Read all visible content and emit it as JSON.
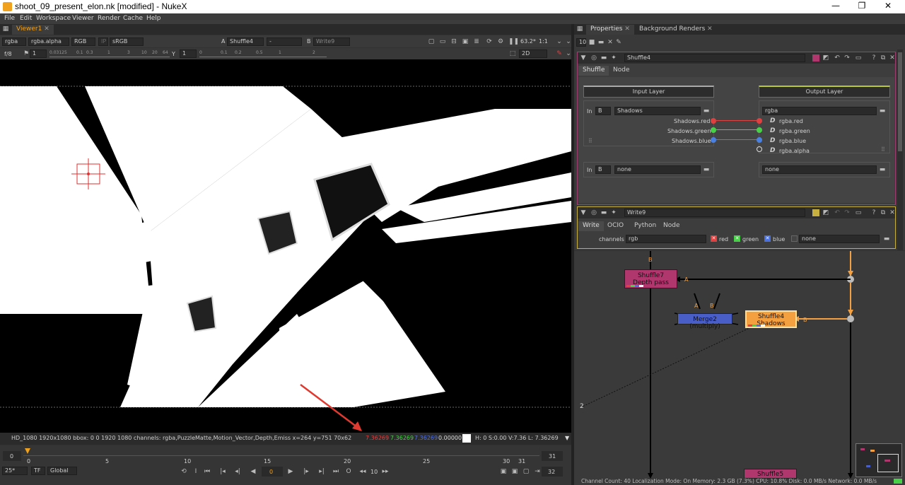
{
  "window": {
    "title": "shoot_09_present_elon.nk [modified] - NukeX",
    "minimize": "—",
    "maximize": "❐",
    "close": "✕"
  },
  "menu": [
    "File",
    "Edit",
    "Workspace",
    "Viewer",
    "Render",
    "Cache",
    "Help"
  ],
  "viewer": {
    "tab_label": "Viewer1",
    "channels": "rgba",
    "alpha": "rgba.alpha",
    "rgb": "RGB",
    "ip": "IP",
    "colorspace": "sRGB",
    "a_label": "A",
    "a_input": "Shuffle4",
    "dash": "-",
    "b_label": "B",
    "b_input": "Write9",
    "zoom": "63.2*",
    "ratio": "1:1",
    "fstop": "f/8",
    "gain": "1",
    "gamma_label": "Y",
    "gamma": "1",
    "mode": "2D",
    "gain_ticks": [
      "0.03125",
      "0.1",
      "0.3",
      "1",
      "3",
      "10",
      "20",
      "64"
    ],
    "gamma_ticks": [
      "0",
      "0.1",
      "0.2",
      "0.5",
      "1",
      "2"
    ]
  },
  "status": {
    "format": "HD_1080 1920x1080  bbox: 0 0 1920 1080 channels: rgba,PuzzleMatte,Motion_Vector,Depth,Emiss  x=264 y=751 70x62",
    "r": "7.36269",
    "g": "7.36269",
    "b": "7.36269",
    "a": "0.00000",
    "hsv": "H:   0 S:0.00 V:7.36  L: 7.36269",
    "color_red": "#e04040",
    "color_green": "#48d048",
    "color_blue": "#5070e0"
  },
  "timeline": {
    "start": "0",
    "end": "31",
    "ticks": [
      "0",
      "5",
      "10",
      "15",
      "20",
      "25",
      "30",
      "31"
    ],
    "fps": "25*",
    "tf": "TF",
    "range": "Global",
    "current_frame": "0",
    "skip": "10",
    "last": "32"
  },
  "properties": {
    "tab_properties": "Properties",
    "tab_background": "Background Renders",
    "max_panels": "10",
    "shuffle": {
      "name": "Shuffle4",
      "tab_shuffle": "Shuffle",
      "tab_node": "Node",
      "input_layer_label": "Input Layer",
      "output_layer_label": "Output Layer",
      "in_label": "In",
      "b_label": "B",
      "input_layer": "Shadows",
      "output_layer": "rgba",
      "in_channels": [
        "Shadows.red",
        "Shadows.green",
        "Shadows.blue"
      ],
      "out_channels": [
        "rgba.red",
        "rgba.green",
        "rgba.blue",
        "rgba.alpha"
      ],
      "in_label2": "In",
      "b_label2": "B",
      "input_layer2": "none",
      "output_layer2": "none"
    },
    "write": {
      "name": "Write9",
      "tabs": [
        "Write",
        "OCIO",
        "Python",
        "Node"
      ],
      "channels_label": "channels",
      "channels": "rgb",
      "red": "red",
      "green": "green",
      "blue": "blue",
      "extra": "none"
    }
  },
  "nodegraph": {
    "shuffle7": [
      "Shuffle7",
      "Depth pass"
    ],
    "merge": "Merge2 (multiply)",
    "shuffle4": [
      "Shuffle4",
      "Shadows"
    ],
    "shuffle5": "Shuffle5",
    "label_b_top": "B",
    "label_a": "A",
    "label_merge_a": "A",
    "label_merge_b": "B",
    "label_b_right": "B",
    "label_2": "2",
    "colors": {
      "shuffle": "#b0366e",
      "merge": "#4a5ec8",
      "selected": "#f4a040"
    }
  },
  "footer": "Channel Count: 40  Localization Mode: On  Memory: 2.3 GB (7.3%)  CPU: 10.8%  Disk: 0.0 MB/s  Network: 0.0 MB/s"
}
